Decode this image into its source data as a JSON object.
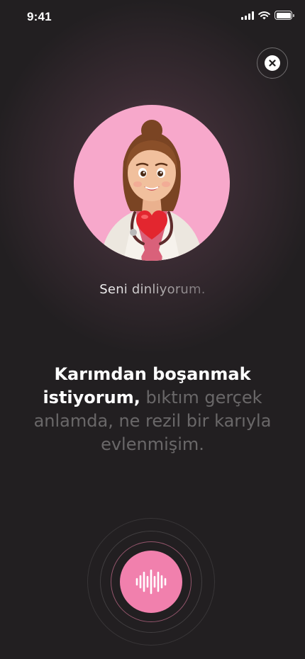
{
  "status_bar": {
    "time": "9:41"
  },
  "assistant": {
    "listening_label": "Seni dinliyorum."
  },
  "transcript": {
    "spoken": "Karımdan boşanmak istiyorum,",
    "pending": "bıktım gerçek anlamda, ne rezil bir karıyla evlenmişim."
  },
  "colors": {
    "accent": "#f180ad",
    "avatar_background": "#f7a8cb",
    "background": "#221f21"
  },
  "icons": {
    "close": "close-icon",
    "mic": "waveform-icon",
    "avatar": "doctor-avatar"
  }
}
